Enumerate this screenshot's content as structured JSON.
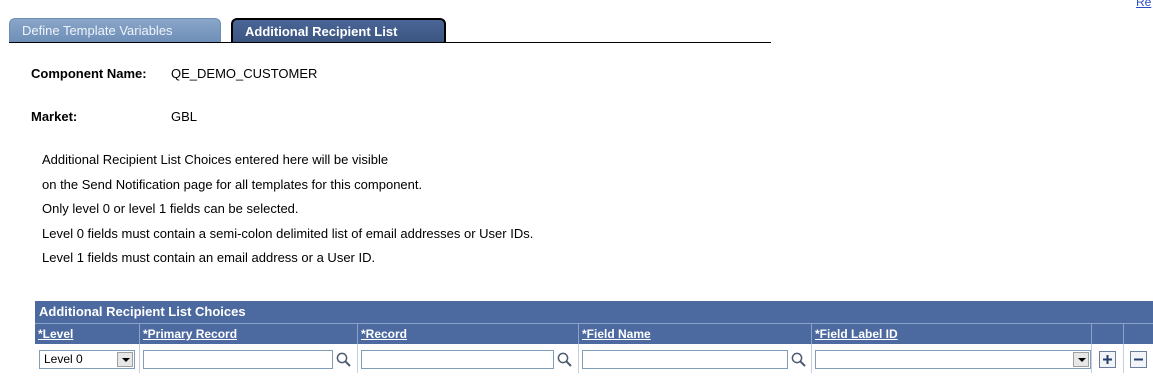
{
  "corner_link": "Re",
  "tabs": [
    {
      "label": "Define Template Variables",
      "active": false
    },
    {
      "label": "Additional Recipient List",
      "active": true
    }
  ],
  "component": {
    "label": "Component Name:",
    "value": "QE_DEMO_CUSTOMER"
  },
  "market": {
    "label": "Market:",
    "value": "GBL"
  },
  "instructions": [
    "Additional Recipient List Choices entered here will be visible",
    "on the Send Notification page for all templates for this component.",
    "Only level 0 or level 1 fields can be selected.",
    "Level 0 fields must contain a semi-colon delimited list of email addresses or User IDs.",
    "Level 1 fields must contain an email address or a User ID."
  ],
  "grid": {
    "title": "Additional Recipient List Choices",
    "columns": [
      "*Level",
      "*Primary Record",
      "*Record",
      "*Field Name",
      "*Field Label ID"
    ],
    "row": {
      "level": "Level 0",
      "primary_record": "",
      "record": "",
      "field_name": "",
      "field_label_id": ""
    }
  },
  "colors": {
    "header_bg": "#4d6aa0",
    "tab_active": "#3b557f",
    "tab_inactive": "#7a98bf"
  },
  "icons": [
    "search-icon",
    "dropdown-arrow-icon",
    "plus-icon",
    "minus-icon"
  ]
}
